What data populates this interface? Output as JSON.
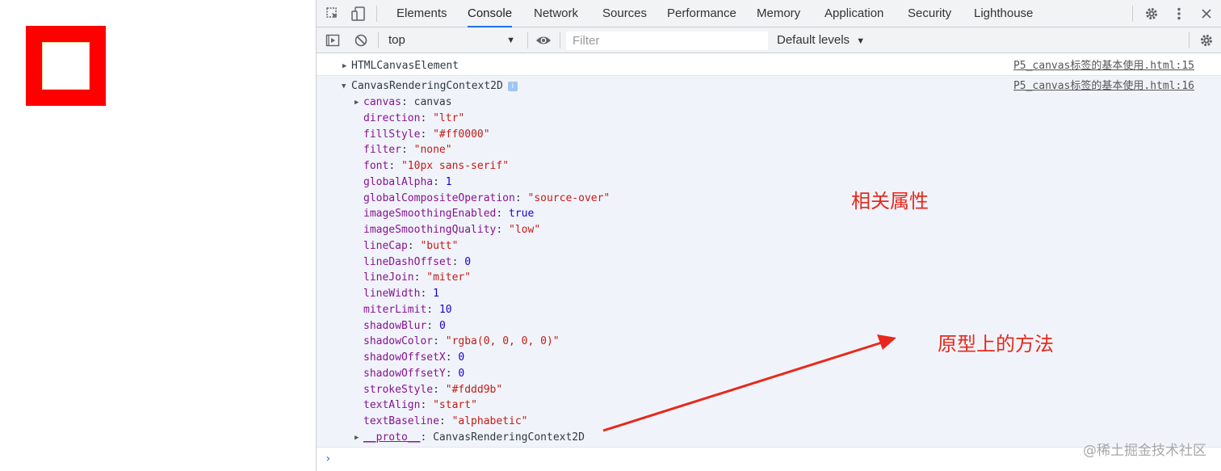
{
  "page": {
    "canvas_fill_color": "#ff0000",
    "canvas_stroke_color": "#fddd9b"
  },
  "devtools": {
    "tabs": [
      {
        "label": "Elements"
      },
      {
        "label": "Console"
      },
      {
        "label": "Network"
      },
      {
        "label": "Sources"
      },
      {
        "label": "Performance"
      },
      {
        "label": "Memory"
      },
      {
        "label": "Application"
      },
      {
        "label": "Security"
      },
      {
        "label": "Lighthouse"
      }
    ],
    "active_tab": "Console",
    "icons": [
      "inspect-icon",
      "device-toolbar-icon",
      "gear-icon",
      "more-icon",
      "sidebar-icon",
      "clear-icon",
      "eye-icon",
      "settings-icon"
    ]
  },
  "console_toolbar": {
    "context": "top",
    "filter_placeholder": "Filter",
    "levels": "Default levels"
  },
  "messages": [
    {
      "object": "HTMLCanvasElement",
      "source": "P5_canvas标签的基本使用.html:15"
    },
    {
      "object": "CanvasRenderingContext2D",
      "source": "P5_canvas标签的基本使用.html:16",
      "info": "i"
    }
  ],
  "properties": [
    {
      "key": "canvas",
      "value": "canvas",
      "kind": "obj",
      "expandable": true
    },
    {
      "key": "direction",
      "value": "\"ltr\"",
      "kind": "s"
    },
    {
      "key": "fillStyle",
      "value": "\"#ff0000\"",
      "kind": "s"
    },
    {
      "key": "filter",
      "value": "\"none\"",
      "kind": "s"
    },
    {
      "key": "font",
      "value": "\"10px sans-serif\"",
      "kind": "s"
    },
    {
      "key": "globalAlpha",
      "value": "1",
      "kind": "n"
    },
    {
      "key": "globalCompositeOperation",
      "value": "\"source-over\"",
      "kind": "s"
    },
    {
      "key": "imageSmoothingEnabled",
      "value": "true",
      "kind": "b"
    },
    {
      "key": "imageSmoothingQuality",
      "value": "\"low\"",
      "kind": "s"
    },
    {
      "key": "lineCap",
      "value": "\"butt\"",
      "kind": "s"
    },
    {
      "key": "lineDashOffset",
      "value": "0",
      "kind": "n"
    },
    {
      "key": "lineJoin",
      "value": "\"miter\"",
      "kind": "s"
    },
    {
      "key": "lineWidth",
      "value": "1",
      "kind": "n"
    },
    {
      "key": "miterLimit",
      "value": "10",
      "kind": "n"
    },
    {
      "key": "shadowBlur",
      "value": "0",
      "kind": "n"
    },
    {
      "key": "shadowColor",
      "value": "\"rgba(0, 0, 0, 0)\"",
      "kind": "s"
    },
    {
      "key": "shadowOffsetX",
      "value": "0",
      "kind": "n"
    },
    {
      "key": "shadowOffsetY",
      "value": "0",
      "kind": "n"
    },
    {
      "key": "strokeStyle",
      "value": "\"#fddd9b\"",
      "kind": "s"
    },
    {
      "key": "textAlign",
      "value": "\"start\"",
      "kind": "s"
    },
    {
      "key": "textBaseline",
      "value": "\"alphabetic\"",
      "kind": "s"
    },
    {
      "key": "__proto__",
      "value": "CanvasRenderingContext2D",
      "kind": "obj",
      "expandable": true
    }
  ],
  "prompt_symbol": "›",
  "annotations": {
    "properties_label": "相关属性",
    "prototype_label": "原型上的方法",
    "color": "#e8281c"
  },
  "watermark": "@稀土掘金技术社区"
}
